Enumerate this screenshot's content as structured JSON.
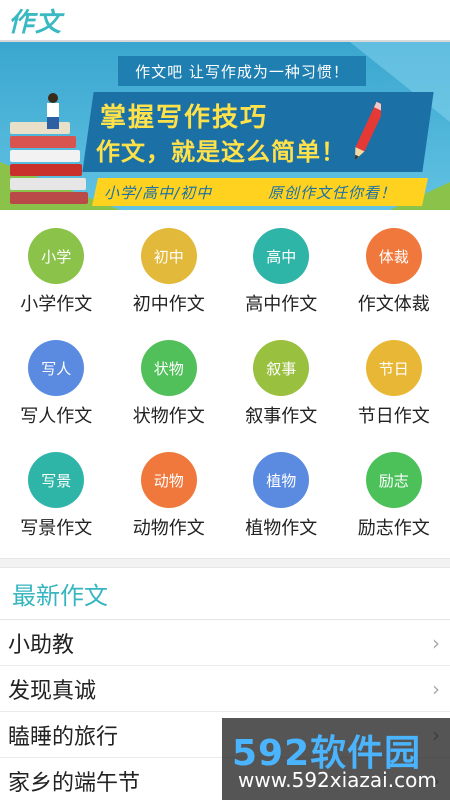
{
  "header": {
    "title": "作文"
  },
  "banner": {
    "slogan": "作文吧  让写作成为一种习惯！",
    "headline1": "掌握写作技巧",
    "headline2": "作文，就是这么简单！",
    "tag_left": "小学/高中/初中",
    "tag_right": "原创作文任你看！"
  },
  "categories": [
    {
      "icon_text": "小学",
      "label": "小学作文",
      "color": "#8bc34a"
    },
    {
      "icon_text": "初中",
      "label": "初中作文",
      "color": "#e2b93b"
    },
    {
      "icon_text": "高中",
      "label": "高中作文",
      "color": "#2fb4a8"
    },
    {
      "icon_text": "体裁",
      "label": "作文体裁",
      "color": "#f0783c"
    },
    {
      "icon_text": "写人",
      "label": "写人作文",
      "color": "#5b8be0"
    },
    {
      "icon_text": "状物",
      "label": "状物作文",
      "color": "#52c05a"
    },
    {
      "icon_text": "叙事",
      "label": "叙事作文",
      "color": "#9ac040"
    },
    {
      "icon_text": "节日",
      "label": "节日作文",
      "color": "#e8b735"
    },
    {
      "icon_text": "写景",
      "label": "写景作文",
      "color": "#2fb4a8"
    },
    {
      "icon_text": "动物",
      "label": "动物作文",
      "color": "#f0783c"
    },
    {
      "icon_text": "植物",
      "label": "植物作文",
      "color": "#5b8be0"
    },
    {
      "icon_text": "励志",
      "label": "励志作文",
      "color": "#4cc15a"
    }
  ],
  "latest": {
    "title": "最新作文",
    "items": [
      {
        "title": "小助教"
      },
      {
        "title": "发现真诚"
      },
      {
        "title": "瞌睡的旅行"
      },
      {
        "title": "家乡的端午节"
      }
    ]
  },
  "watermark": {
    "brand": "592软件园",
    "url": "www.592xiazai.com"
  }
}
